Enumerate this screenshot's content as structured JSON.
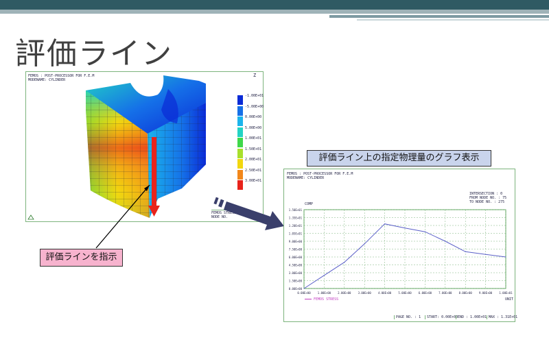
{
  "slide": {
    "title": "評価ライン",
    "colors": {
      "topbar": "#2f5a63",
      "accent": "#7d9aa2"
    }
  },
  "model_view": {
    "header_line1": "FEMOS : POST-PROCESSOR FOR F.E.M",
    "header_line2": "MODENAME: CYLINDER",
    "legend_values": [
      "-1.00E+01",
      "-5.00E+00",
      "0.00E+00",
      "5.00E+00",
      "1.00E+01",
      "1.50E+01",
      "2.00E+01",
      "2.50E+01",
      "3.00E+01"
    ],
    "legend_colors": [
      "#0a2bd6",
      "#1570e8",
      "#1bb4ec",
      "#22d3c4",
      "#3fd84a",
      "#a8e02c",
      "#f2d70f",
      "#f2871a",
      "#e8231b"
    ],
    "footer_line1": "FEMOS STRESS",
    "footer_line2": "NODE NO.",
    "axis_glyph": "Z"
  },
  "callouts": {
    "graph_caption": "評価ライン上の指定物理量のグラフ表示",
    "line_caption": "評価ラインを指示"
  },
  "graph_view": {
    "header_line1": "FEMOS : POST-PROCESSOR FOR F.E.M",
    "header_line2": "MODENAME: CYLINDER",
    "info_line1": "INTERSECTION : 0",
    "info_line2": "FROM NODE NO. : 75",
    "info_line3": "TO NODE NO. : 275",
    "y_axis_title": "COMP",
    "x_unit": "UNIT",
    "legend_entry": "FEMOS STRESS",
    "footer_cells": [
      "PAGE NO. : 1",
      "START: 0.00E+00",
      "END : 1.00E+01",
      "MAX : 1.31E+01"
    ]
  },
  "chart_data": {
    "type": "line",
    "x": [
      0.0,
      1.0,
      2.0,
      3.0,
      4.0,
      5.0,
      6.0,
      7.0,
      8.0,
      9.0,
      10.0
    ],
    "series": [
      {
        "name": "FEMOS STRESS",
        "values": [
          0.0,
          2.5,
          5.0,
          8.5,
          12.3,
          11.5,
          10.8,
          9.0,
          7.0,
          6.5,
          6.0
        ]
      }
    ],
    "x_tick_labels": [
      "0.00E+00",
      "1.00E+00",
      "2.00E+00",
      "3.00E+00",
      "4.00E+00",
      "5.00E+00",
      "6.00E+00",
      "7.00E+00",
      "8.00E+00",
      "9.00E+00",
      "1.00E+01"
    ],
    "y_tick_labels": [
      "0.00E+00",
      "1.50E+00",
      "3.00E+00",
      "4.50E+00",
      "6.00E+00",
      "7.50E+00",
      "9.00E+00",
      "1.05E+01",
      "1.20E+01",
      "1.35E+01",
      "1.50E+01"
    ],
    "xlim": [
      0,
      10
    ],
    "ylim": [
      0,
      15
    ],
    "grid": true,
    "legend_position": "bottom-left",
    "line_color": "#5a5fc8"
  }
}
